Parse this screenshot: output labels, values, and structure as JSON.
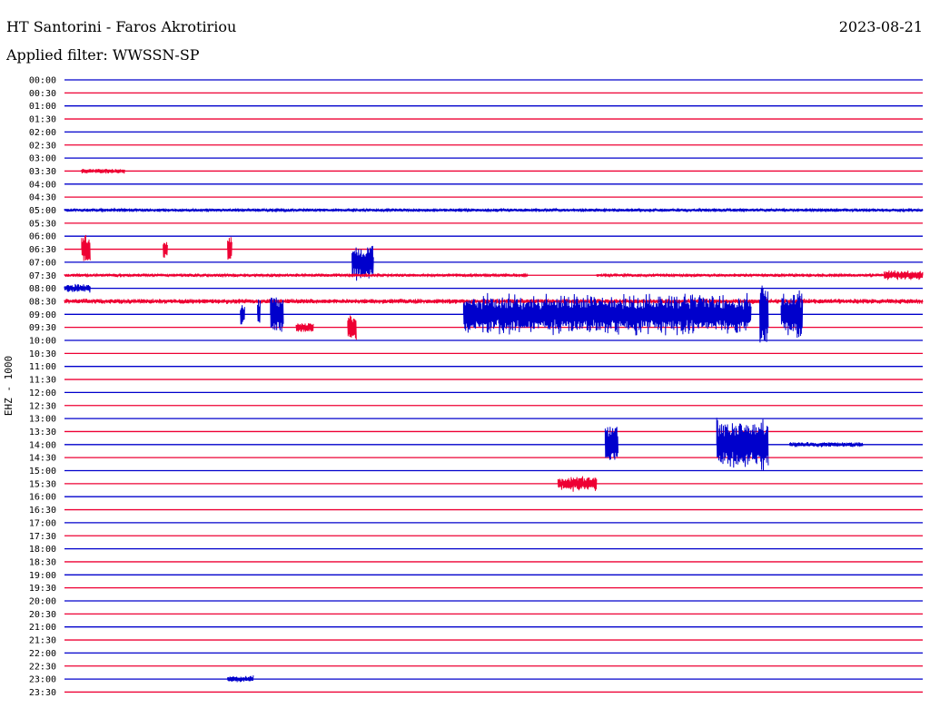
{
  "header": {
    "station": "HT Santorini - Faros Akrotiriou",
    "date": "2023-08-21",
    "filter": "Applied filter: WWSSN-SP"
  },
  "chart_data": {
    "type": "line",
    "title": "HT Santorini - Faros Akrotiriou",
    "subtitle": "Applied filter: WWSSN-SP",
    "ylabel": "EHZ - 1000",
    "rows": [
      "00:00",
      "00:30",
      "01:00",
      "01:30",
      "02:00",
      "02:30",
      "03:00",
      "03:30",
      "04:00",
      "04:30",
      "05:00",
      "05:30",
      "06:00",
      "06:30",
      "07:00",
      "07:30",
      "08:00",
      "08:30",
      "09:00",
      "09:30",
      "10:00",
      "10:30",
      "11:00",
      "11:30",
      "12:00",
      "12:30",
      "13:00",
      "13:30",
      "14:00",
      "14:30",
      "15:00",
      "15:30",
      "16:00",
      "16:30",
      "17:00",
      "17:30",
      "18:00",
      "18:30",
      "19:00",
      "19:30",
      "20:00",
      "20:30",
      "21:00",
      "21:30",
      "22:00",
      "22:30",
      "23:00",
      "23:30"
    ],
    "colors": [
      "#0000cc",
      "#ee0033"
    ],
    "x_range_minutes": [
      0,
      30
    ],
    "events": [
      {
        "row": "03:30",
        "start": 0.02,
        "end": 0.07,
        "amp": 3
      },
      {
        "row": "05:00",
        "start": 0.0,
        "end": 1.0,
        "amp": 2
      },
      {
        "row": "06:30",
        "start": 0.02,
        "end": 0.03,
        "amp": 16
      },
      {
        "row": "06:30",
        "start": 0.115,
        "end": 0.12,
        "amp": 10
      },
      {
        "row": "06:30",
        "start": 0.19,
        "end": 0.195,
        "amp": 14
      },
      {
        "row": "07:00",
        "start": 0.335,
        "end": 0.36,
        "amp": 22
      },
      {
        "row": "07:30",
        "start": 0.0,
        "end": 0.54,
        "amp": 2
      },
      {
        "row": "07:30",
        "start": 0.62,
        "end": 1.0,
        "amp": 2
      },
      {
        "row": "07:30",
        "start": 0.955,
        "end": 1.0,
        "amp": 6
      },
      {
        "row": "08:00",
        "start": 0.0,
        "end": 0.03,
        "amp": 5
      },
      {
        "row": "08:30",
        "start": 0.0,
        "end": 1.0,
        "amp": 3
      },
      {
        "row": "09:00",
        "start": 0.205,
        "end": 0.21,
        "amp": 12
      },
      {
        "row": "09:00",
        "start": 0.225,
        "end": 0.228,
        "amp": 18
      },
      {
        "row": "09:00",
        "start": 0.24,
        "end": 0.255,
        "amp": 20
      },
      {
        "row": "09:00",
        "start": 0.465,
        "end": 0.8,
        "amp": 24
      },
      {
        "row": "09:00",
        "start": 0.81,
        "end": 0.82,
        "amp": 32
      },
      {
        "row": "09:00",
        "start": 0.835,
        "end": 0.86,
        "amp": 30
      },
      {
        "row": "09:30",
        "start": 0.27,
        "end": 0.29,
        "amp": 5
      },
      {
        "row": "09:30",
        "start": 0.33,
        "end": 0.34,
        "amp": 14
      },
      {
        "row": "14:00",
        "start": 0.63,
        "end": 0.645,
        "amp": 20
      },
      {
        "row": "14:00",
        "start": 0.76,
        "end": 0.82,
        "amp": 32
      },
      {
        "row": "14:00",
        "start": 0.845,
        "end": 0.93,
        "amp": 3
      },
      {
        "row": "15:30",
        "start": 0.575,
        "end": 0.62,
        "amp": 9
      },
      {
        "row": "23:00",
        "start": 0.19,
        "end": 0.22,
        "amp": 4
      }
    ]
  }
}
